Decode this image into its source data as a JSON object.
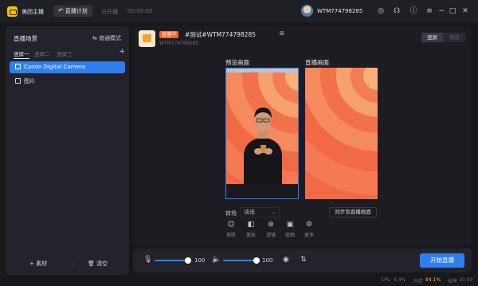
{
  "titlebar": {
    "app_title": "美团主播",
    "plan_button": "直播计划",
    "status_text": "已开播",
    "timer": "00:00:00",
    "user_name": "WTM774798285"
  },
  "scenes": {
    "title": "直播场景",
    "mode_button": "普通模式",
    "tabs": [
      "竖屏一",
      "竖屏二",
      "竖屏三"
    ],
    "sources": [
      "Canon Digital Camera",
      "图片"
    ],
    "add_material": "+ 素材",
    "clear": "清空"
  },
  "room": {
    "badge": "直播中",
    "title": "#测试#WTM774798285",
    "subtitle": "WTM774798285",
    "orient_portrait": "竖屏",
    "orient_landscape": "横屏"
  },
  "preview": {
    "preview_label": "预览画面",
    "live_label": "直播画面",
    "transition_label": "转场",
    "transition_value": "淡出",
    "sync_button": "同步到直播画面",
    "tools": [
      "美肤",
      "美妆",
      "滤镜",
      "抠图",
      "更多"
    ]
  },
  "audio": {
    "mic_volume": 100,
    "speaker_volume": 100,
    "start_button": "开始直播"
  },
  "status": {
    "cpu_label": "CPU",
    "cpu_value": "4.4%",
    "mem_label": "内存",
    "mem_value": "84.1%",
    "fps_label": "帧率",
    "fps_value": "30.00"
  },
  "colors": {
    "accent": "#2f7ff0",
    "live_badge": "#f06a2a",
    "memory_warning": "#f0b429"
  }
}
